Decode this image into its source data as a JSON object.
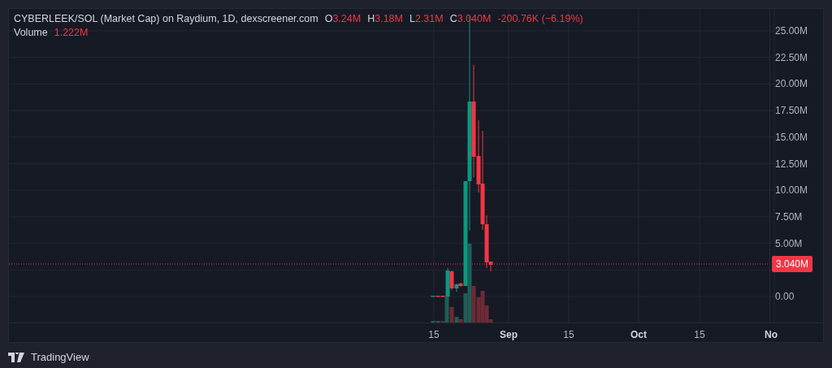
{
  "legend": {
    "title": "CYBERLEEK/SOL (Market Cap) on Raydium, 1D, dexscreener.com",
    "values": [
      {
        "label": "O",
        "value": "3.24M"
      },
      {
        "label": "H",
        "value": "3.18M"
      },
      {
        "label": "L",
        "value": "2.31M"
      },
      {
        "label": "C",
        "value": "3.040M"
      }
    ],
    "change": "-200.76K (−6.19%)",
    "volume_label": "Volume",
    "volume_value": "1.222M"
  },
  "price_axis": {
    "labels": [
      "25.00M",
      "22.50M",
      "20.00M",
      "17.50M",
      "15.00M",
      "12.50M",
      "10.00M",
      "7.50M",
      "5.00M",
      "0.00"
    ],
    "last_price": "3.040M"
  },
  "time_axis": {
    "labels": [
      {
        "text": "15",
        "kind": "day"
      },
      {
        "text": "Sep",
        "kind": "month"
      },
      {
        "text": "15",
        "kind": "day"
      },
      {
        "text": "Oct",
        "kind": "month"
      },
      {
        "text": "15",
        "kind": "day"
      },
      {
        "text": "No",
        "kind": "month"
      }
    ]
  },
  "footer": {
    "brand": "TradingView"
  }
}
